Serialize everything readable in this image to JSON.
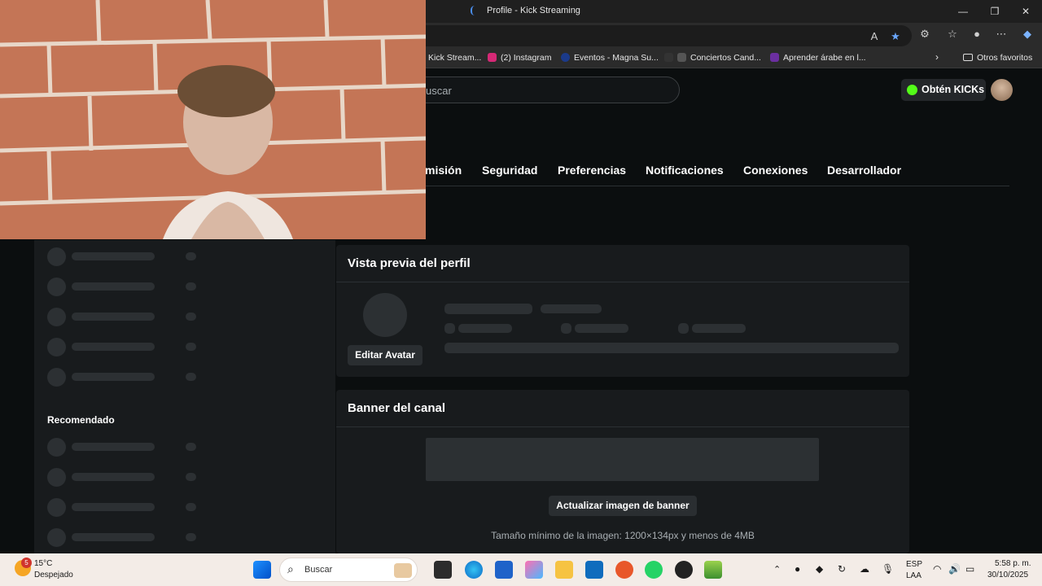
{
  "browser": {
    "tab_title": "Profile - Kick Streaming",
    "window_controls": {
      "minimize": "—",
      "maximize": "❐",
      "close": "✕"
    },
    "bookmarks": [
      {
        "label": "Kick Stream...",
        "color": "#53fc18"
      },
      {
        "label": "(2) Instagram",
        "color": "#d62976"
      },
      {
        "label": "Eventos - Magna Su...",
        "color": "#1b3a8a"
      },
      {
        "label": "Conciertos Cand...",
        "color": "#333333"
      },
      {
        "label": "Aprender árabe en l...",
        "color": "#6b2fa0"
      }
    ],
    "other_bookmarks": "Otros favoritos"
  },
  "kick": {
    "search_placeholder": "uscar",
    "kicks_button": "Obtén KICKs",
    "nav_tabs": [
      "misión",
      "Seguridad",
      "Preferencias",
      "Notificaciones",
      "Conexiones",
      "Desarrollador"
    ],
    "sidebar_recommended": "Recomendado",
    "profile_preview_title": "Vista previa del perfil",
    "edit_avatar": "Editar Avatar",
    "banner_title": "Banner del canal",
    "update_banner": "Actualizar imagen de banner",
    "banner_hint": "Tamaño mínimo de la imagen: 1200×134px y menos de 4MB",
    "accent_color": "#53fc18"
  },
  "taskbar": {
    "weather_temp": "15°C",
    "weather_desc": "Despejado",
    "weather_badge": "5",
    "search_label": "Buscar",
    "lang_1": "ESP",
    "lang_2": "LAA",
    "time": "5:58 p. m.",
    "date": "30/10/2025"
  }
}
